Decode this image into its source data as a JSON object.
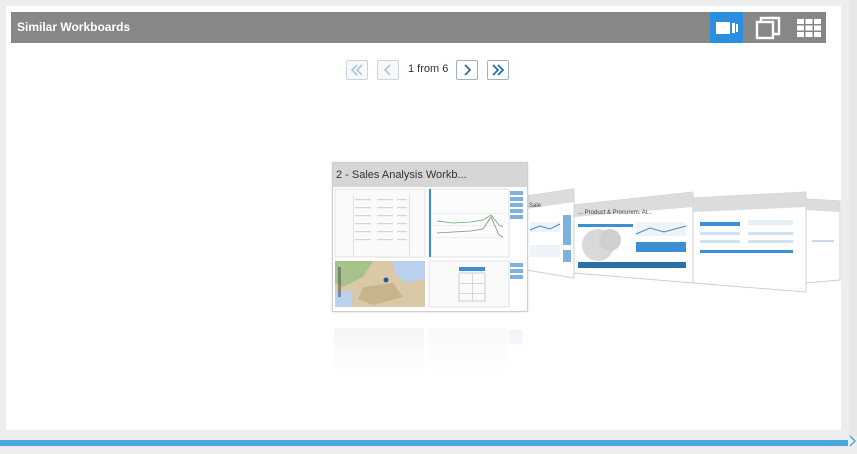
{
  "widget": {
    "title": "Similar Workboards"
  },
  "view_modes": [
    {
      "name": "coverflow-view-button",
      "icon": "coverflow-icon",
      "active": true
    },
    {
      "name": "cascade-view-button",
      "icon": "cascade-icon",
      "active": false
    },
    {
      "name": "grid-view-button",
      "icon": "grid-icon",
      "active": false
    }
  ],
  "pager": {
    "status": "1 from 6",
    "first_enabled": false,
    "prev_enabled": false,
    "next_enabled": true,
    "last_enabled": true
  },
  "cards": [
    {
      "title": "2 - Sales Analysis Workb...",
      "selected": true
    },
    {
      "title": "Sale",
      "selected": false
    },
    {
      "title": "... Product & Procurem. Al...",
      "selected": false
    },
    {
      "title": "",
      "selected": false
    },
    {
      "title": "",
      "selected": false
    }
  ],
  "colors": {
    "header": "#878787",
    "accent": "#2b8fe0",
    "bottom_bar": "#49a8e2"
  }
}
